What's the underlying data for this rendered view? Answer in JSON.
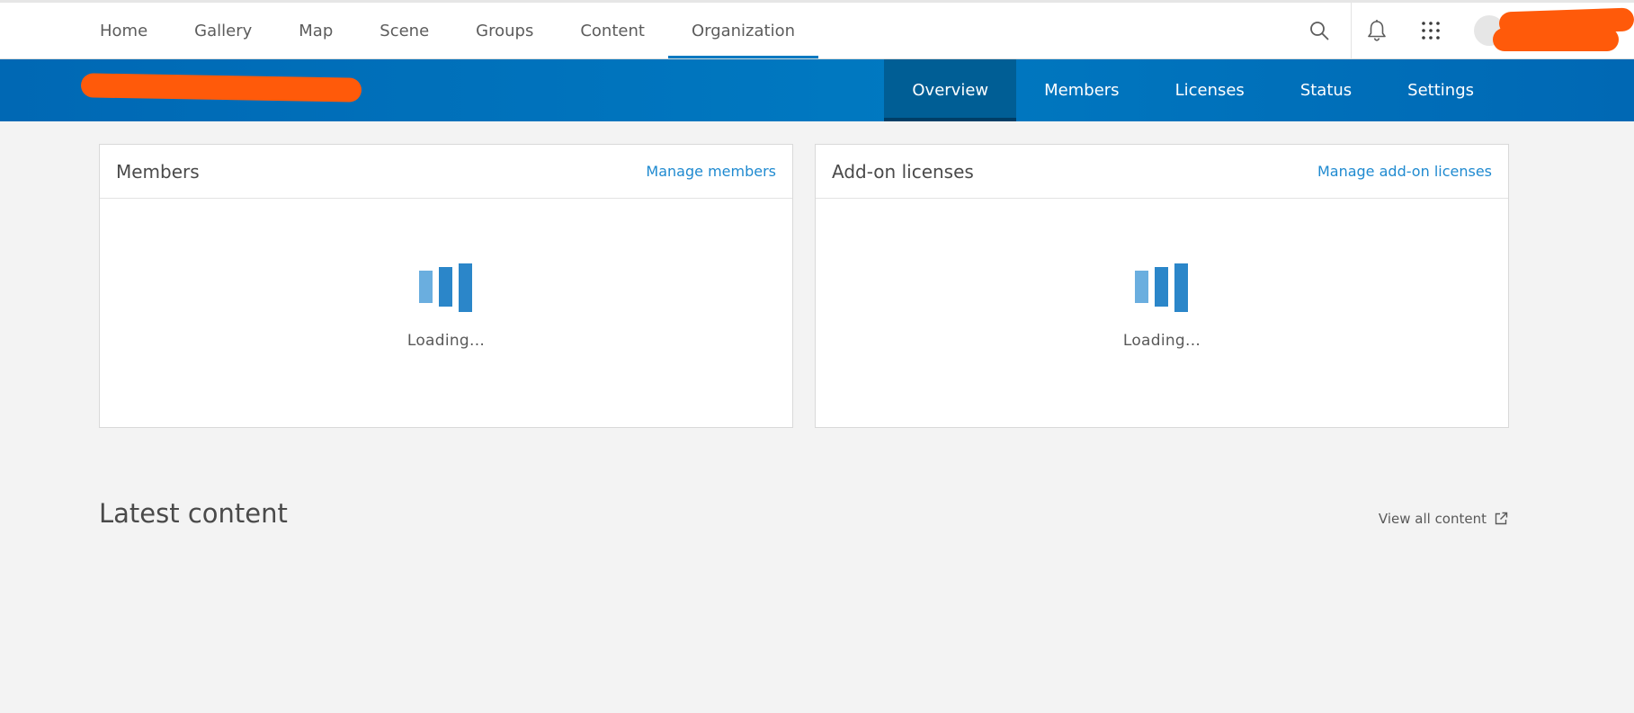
{
  "topnav": {
    "items": [
      {
        "label": "Home",
        "active": false
      },
      {
        "label": "Gallery",
        "active": false
      },
      {
        "label": "Map",
        "active": false
      },
      {
        "label": "Scene",
        "active": false
      },
      {
        "label": "Groups",
        "active": false
      },
      {
        "label": "Content",
        "active": false
      },
      {
        "label": "Organization",
        "active": true
      }
    ],
    "icons": [
      "search-icon",
      "bell-icon",
      "app-launcher-icon"
    ],
    "accent_color": "#0079c1"
  },
  "orgbar": {
    "tabs": [
      {
        "label": "Overview",
        "active": true
      },
      {
        "label": "Members",
        "active": false
      },
      {
        "label": "Licenses",
        "active": false
      },
      {
        "label": "Status",
        "active": false
      },
      {
        "label": "Settings",
        "active": false
      }
    ],
    "background_color": "#0079c1",
    "active_tab_color": "#005e95"
  },
  "cards": {
    "members": {
      "title": "Members",
      "link": "Manage members",
      "loading": "Loading..."
    },
    "licenses": {
      "title": "Add-on licenses",
      "link": "Manage add-on licenses",
      "loading": "Loading..."
    }
  },
  "latest": {
    "title": "Latest content",
    "view_all": "View all content"
  },
  "colors": {
    "link": "#1f8ad0",
    "redaction": "#ff5a0a",
    "page_background": "#f3f3f3"
  }
}
